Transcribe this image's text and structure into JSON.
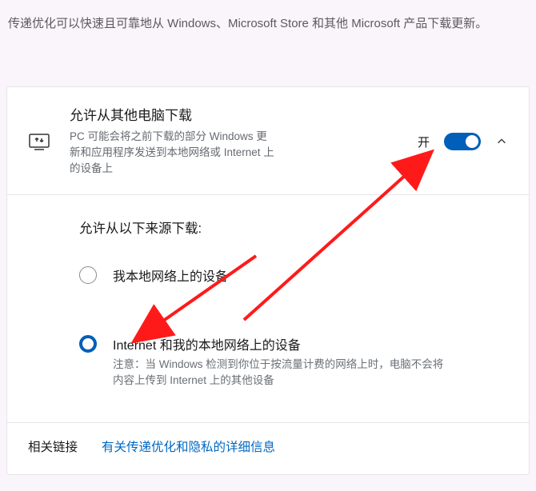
{
  "intro": "传递优化可以快速且可靠地从 Windows、Microsoft Store 和其他 Microsoft 产品下载更新。",
  "settings_card": {
    "title": "允许从其他电脑下载",
    "subtitle": "PC 可能会将之前下载的部分 Windows 更新和应用程序发送到本地网络或 Internet 上的设备上",
    "toggle_state_label": "开",
    "toggle_on": true,
    "expanded": true,
    "source_heading": "允许从以下来源下载:",
    "options": [
      {
        "title": "我本地网络上的设备",
        "note": "",
        "selected": false
      },
      {
        "title": "Internet 和我的本地网络上的设备",
        "note": "注意：当 Windows 检测到你位于按流量计费的网络上时，电脑不会将内容上传到 Internet 上的其他设备",
        "selected": true
      }
    ]
  },
  "footer": {
    "related_label": "相关链接",
    "link_text": "有关传递优化和隐私的详细信息"
  }
}
